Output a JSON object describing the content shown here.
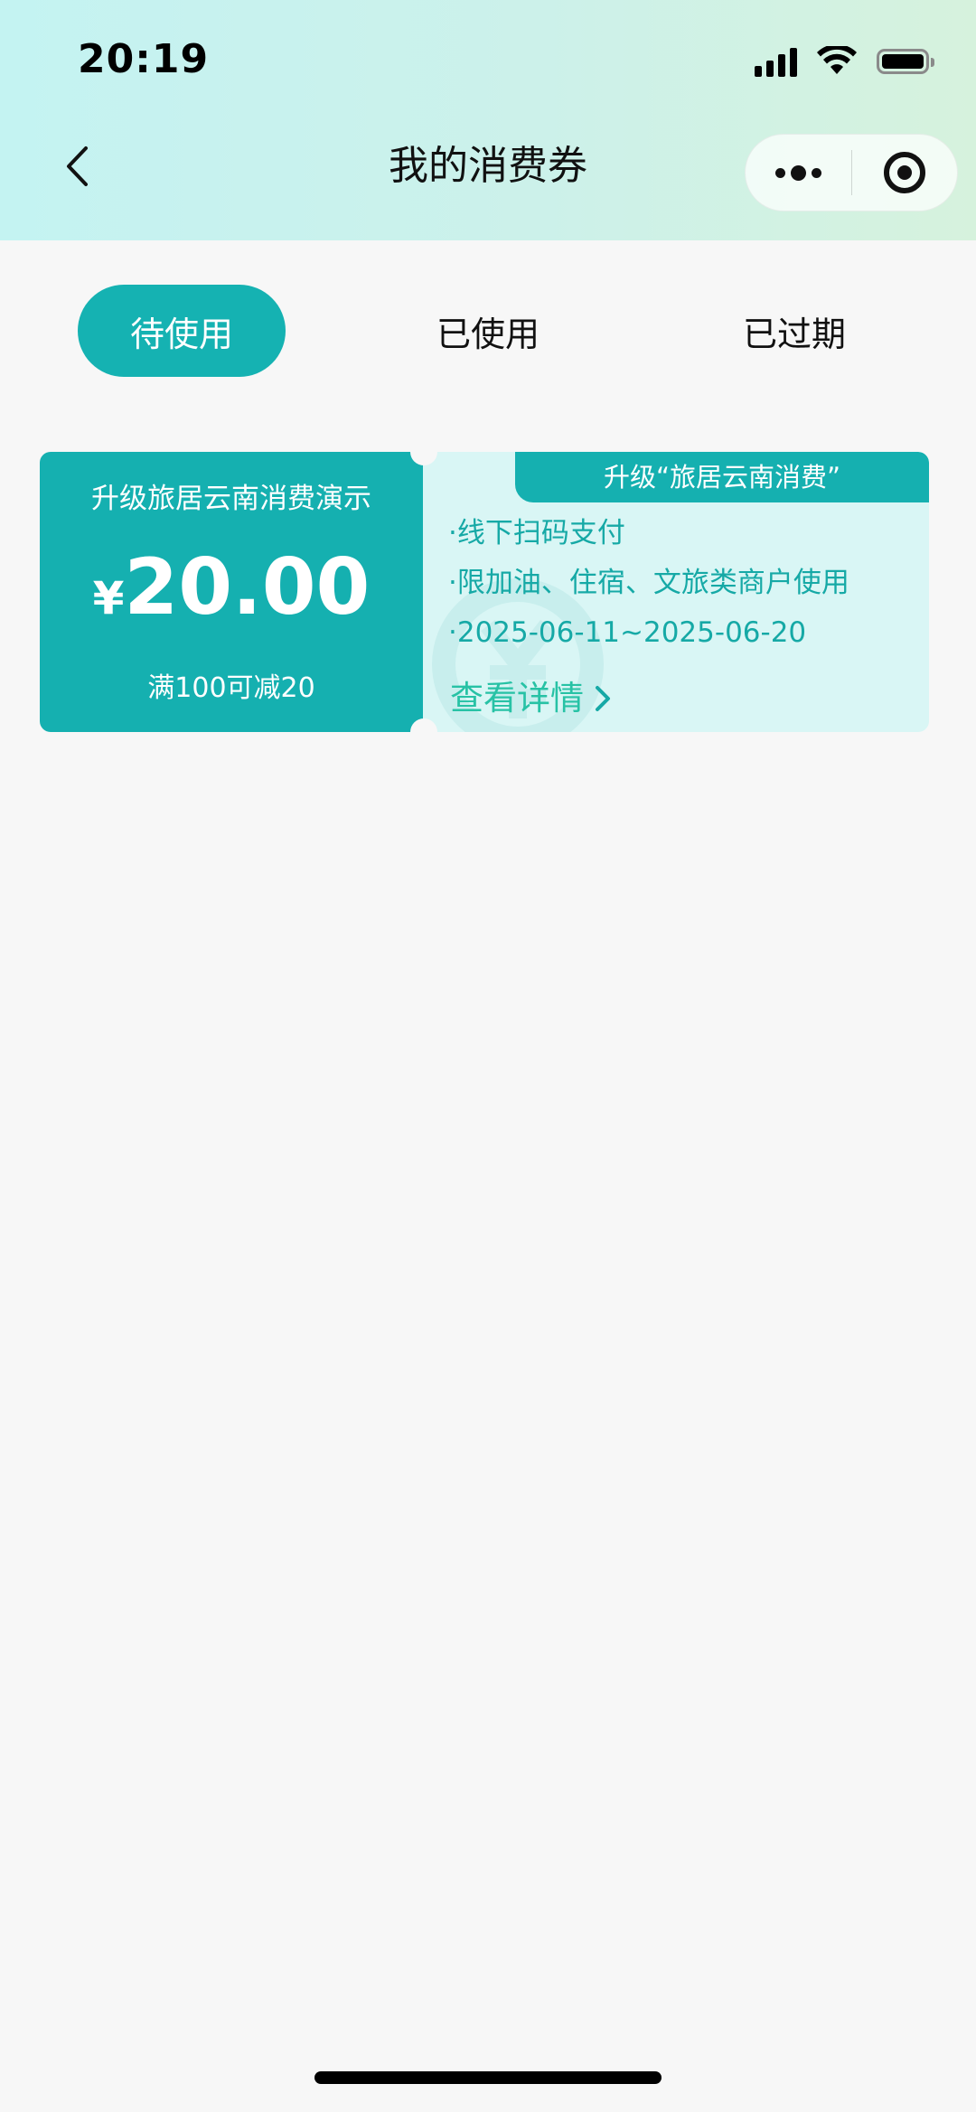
{
  "status_bar": {
    "time": "20:19",
    "icons": [
      "signal-icon",
      "wifi-icon",
      "battery-icon"
    ]
  },
  "nav": {
    "title": "我的消费券",
    "back_icon": "chevron-left-icon",
    "more_icon": "more-dots-icon",
    "close_icon": "target-close-icon"
  },
  "tabs": [
    {
      "label": "待使用",
      "active": true
    },
    {
      "label": "已使用",
      "active": false
    },
    {
      "label": "已过期",
      "active": false
    }
  ],
  "coupon": {
    "name": "升级旅居云南消费演示",
    "currency": "¥",
    "amount": "20.00",
    "threshold": "满100可减20",
    "tag": "升级“旅居云南消费”",
    "rules": [
      "·线下扫码支付",
      "·限加油、住宿、文旅类商户使用",
      "·2025-06-11~2025-06-20"
    ],
    "details_label": "查看详情"
  },
  "colors": {
    "accent": "#15b2b2",
    "coupon_text": "#16a9a6",
    "details_link": "#27c2a5",
    "coupon_bg": "#d9f6f5",
    "page_bg": "#f7f7f7"
  }
}
